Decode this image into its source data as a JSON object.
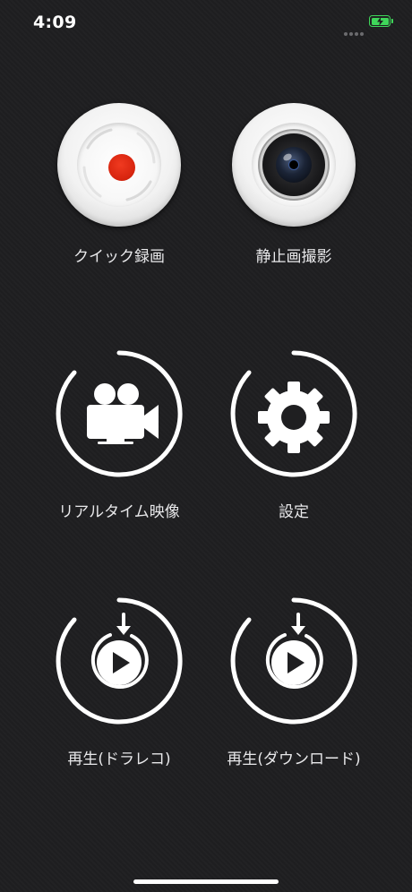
{
  "status_bar": {
    "time": "4:09"
  },
  "menu": [
    {
      "id": "quick-record",
      "label": "クイック録画",
      "icon": "record-button-icon"
    },
    {
      "id": "still-photo",
      "label": "静止画撮影",
      "icon": "camera-lens-icon"
    },
    {
      "id": "realtime-video",
      "label": "リアルタイム映像",
      "icon": "video-camera-icon"
    },
    {
      "id": "settings",
      "label": "設定",
      "icon": "gear-icon"
    },
    {
      "id": "play-dashcam",
      "label": "再生(ドラレコ)",
      "icon": "playback-download-icon"
    },
    {
      "id": "play-download",
      "label": "再生(ダウンロード)",
      "icon": "playback-download-icon"
    }
  ],
  "colors": {
    "background": "#1f1f21",
    "icon_white": "#ffffff",
    "record_red": "#d8250f",
    "battery_green": "#3fd65a"
  }
}
